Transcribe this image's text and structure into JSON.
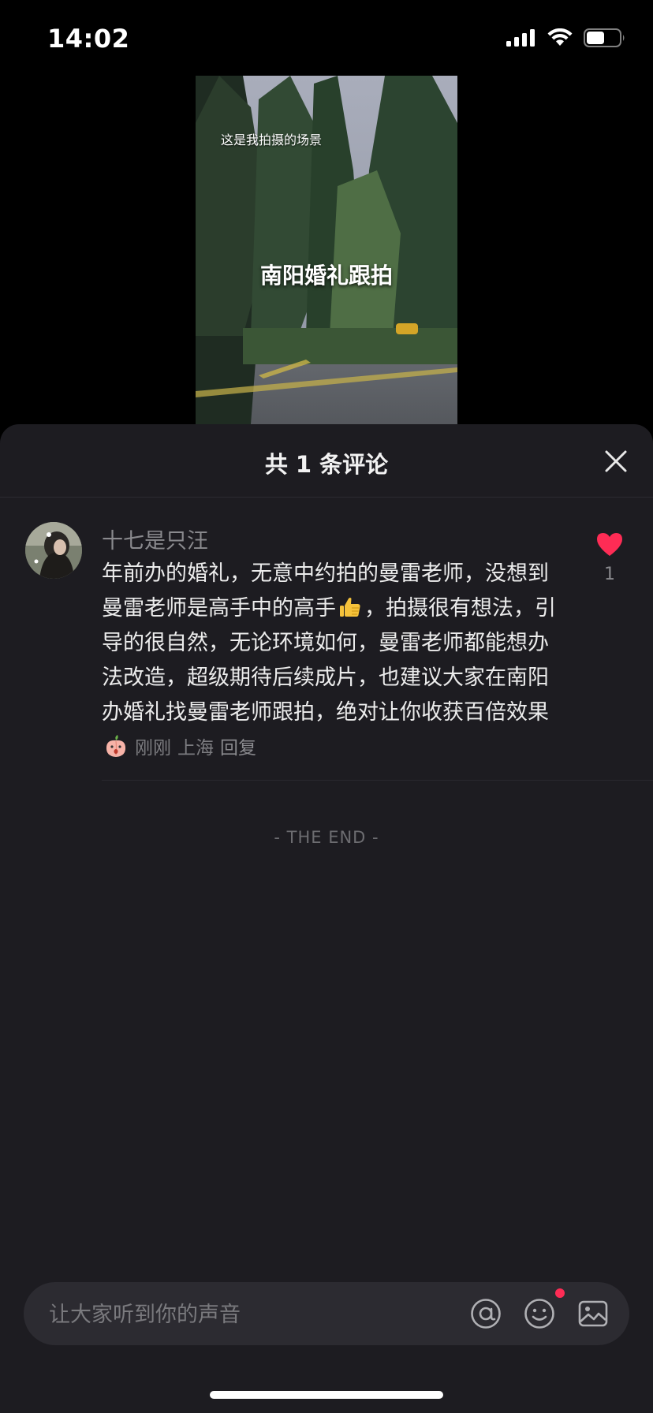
{
  "status_bar": {
    "time": "14:02"
  },
  "video": {
    "caption_small": "这是我拍摄的场景",
    "caption_big": "南阳婚礼跟拍"
  },
  "comments_panel": {
    "title": "共 1 条评论",
    "comment": {
      "username": "十七是只汪",
      "text_part1": "年前办的婚礼，无意中约拍的曼雷老师，没想到曼雷老师是高手中的高手",
      "emoji1": "thumbs-up",
      "text_part2": "，拍摄很有想法，引导的很自然，无论环境如何，曼雷老师都能想办法改造，超级期待后续成片，也建议大家在南阳办婚礼找曼雷老师跟拍，绝对让你收获百倍效果",
      "emoji2": "peach-face",
      "time": "刚刚",
      "location": "上海",
      "reply_label": "回复",
      "like_count": "1",
      "like_color": "#fe2c55"
    },
    "end_label": "- THE END -"
  },
  "input": {
    "placeholder": "让大家听到你的声音",
    "icons": [
      "at-icon",
      "emoji-icon",
      "image-icon"
    ],
    "notify_color": "#fe2c55"
  }
}
